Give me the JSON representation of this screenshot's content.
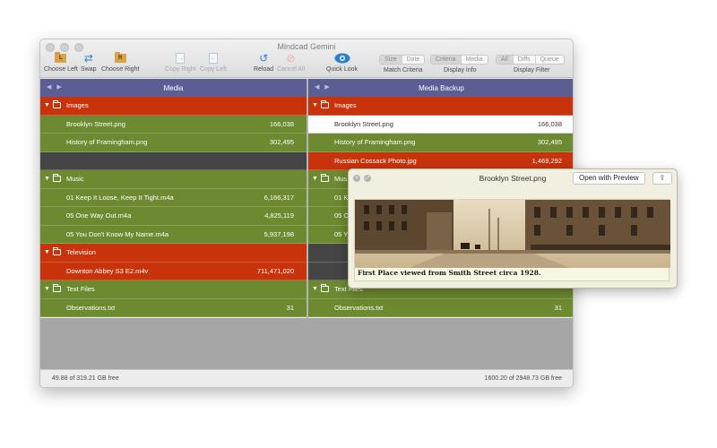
{
  "window": {
    "title": "Mindcad Gemini"
  },
  "toolbar": {
    "choose_left": "Choose Left",
    "swap": "Swap",
    "choose_right": "Choose Right",
    "copy_right": "Copy Right",
    "copy_left": "Copy Left",
    "reload": "Reload",
    "cancel_all": "Cancel All",
    "quick_look": "Quick Look",
    "match_criteria": {
      "label": "Match Criteria",
      "options": [
        "Size",
        "Date"
      ]
    },
    "display_info": {
      "label": "Display Info",
      "options": [
        "Criteria",
        "Media"
      ]
    },
    "display_filter": {
      "label": "Display Filter",
      "options": [
        "All",
        "Diffs",
        "Queue"
      ]
    },
    "colors": {
      "accent": "#3b82c4",
      "folder": "#d7a24a"
    }
  },
  "left_pane": {
    "title": "Media",
    "rows": [
      {
        "kind": "folder",
        "name": "Images",
        "color": "red"
      },
      {
        "kind": "file",
        "name": "Brooklyn Street.png",
        "size": "166,038",
        "color": "green"
      },
      {
        "kind": "file",
        "name": "History of Framingham.png",
        "size": "302,495",
        "color": "green"
      },
      {
        "kind": "empty",
        "color": "dark"
      },
      {
        "kind": "folder",
        "name": "Music",
        "color": "green"
      },
      {
        "kind": "file",
        "name": "01 Keep It Loose, Keep It Tight.m4a",
        "size": "6,166,317",
        "color": "green"
      },
      {
        "kind": "file",
        "name": "05 One Way Out.m4a",
        "size": "4,825,119",
        "color": "green"
      },
      {
        "kind": "file",
        "name": "05 You Don't Know My Name.m4a",
        "size": "5,937,198",
        "color": "green"
      },
      {
        "kind": "folder",
        "name": "Television",
        "color": "red"
      },
      {
        "kind": "file",
        "name": "Downton Abbey S3 E2.m4v",
        "size": "711,471,020",
        "color": "red"
      },
      {
        "kind": "folder",
        "name": "Text Files",
        "color": "green"
      },
      {
        "kind": "file",
        "name": "Observations.txt",
        "size": "31",
        "color": "green"
      }
    ],
    "free_space": "49.88 of 319.21 GB free"
  },
  "right_pane": {
    "title": "Media Backup",
    "rows": [
      {
        "kind": "folder",
        "name": "Images",
        "color": "red"
      },
      {
        "kind": "file",
        "name": "Brooklyn Street.png",
        "size": "166,038",
        "color": "white"
      },
      {
        "kind": "file",
        "name": "History of Framingham.png",
        "size": "302,495",
        "color": "green"
      },
      {
        "kind": "file",
        "name": "Russian Cossack Photo.jpg",
        "size": "1,469,292",
        "color": "red"
      },
      {
        "kind": "folder",
        "name": "Mus",
        "color": "green"
      },
      {
        "kind": "file",
        "name": "01 K",
        "size": "",
        "color": "green"
      },
      {
        "kind": "file",
        "name": "05 O",
        "size": "",
        "color": "green"
      },
      {
        "kind": "file",
        "name": "05 Y",
        "size": "",
        "color": "green"
      },
      {
        "kind": "empty",
        "color": "dark"
      },
      {
        "kind": "empty",
        "color": "dark"
      },
      {
        "kind": "folder",
        "name": "Text Files",
        "color": "green"
      },
      {
        "kind": "file",
        "name": "Observations.txt",
        "size": "31",
        "color": "green"
      }
    ],
    "free_space": "1600.20 of 2948.73 GB free"
  },
  "preview": {
    "title": "Brooklyn Street.png",
    "open_button": "Open with Preview",
    "share_icon": "share-icon",
    "caption": "First Place viewed from Smith Street circa 1928."
  }
}
